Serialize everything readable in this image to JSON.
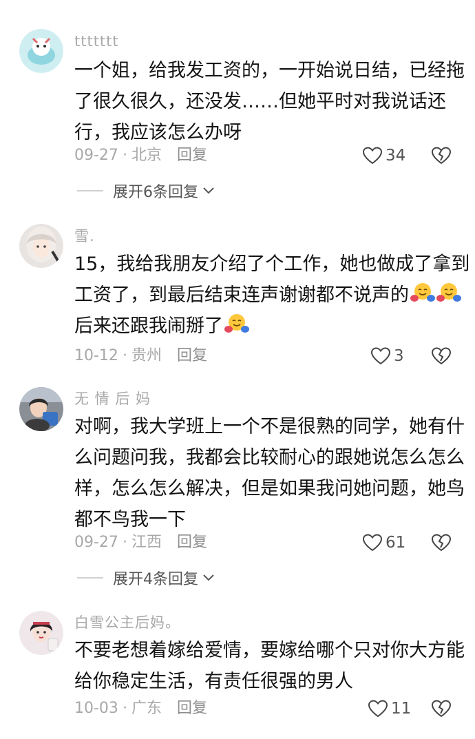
{
  "comments": [
    {
      "username": "ttttttt",
      "lines": [
        "一个姐，给我发工资的，一开始说日结，已经拖",
        "了很久很久，还没发……但她平时对我说话还",
        "行，我应该怎么办呀"
      ],
      "date": "09-27",
      "location": "北京",
      "reply_label": "回复",
      "likes": "34",
      "expand_label": "展开6条回复"
    },
    {
      "username": "雪.",
      "lines": [
        "15，我给我朋友介绍了个工作，她也做成了拿到",
        "工资了，到最后结束连声谢谢都不说声的",
        "后来还跟我闹掰了"
      ],
      "date": "10-12",
      "location": "贵州",
      "reply_label": "回复",
      "likes": "3"
    },
    {
      "username": "无 情 后 妈",
      "lines": [
        "对啊，我大学班上一个不是很熟的同学，她有什",
        "么问题问我，我都会比较耐心的跟她说怎么怎么",
        "样，怎么怎么解决，但是如果我问她问题，她鸟",
        "都不鸟我一下"
      ],
      "date": "09-27",
      "location": "江西",
      "reply_label": "回复",
      "likes": "61",
      "expand_label": "展开4条回复"
    },
    {
      "username": "白雪公主后妈。",
      "lines": [
        "不要老想着嫁给爱情，要嫁给哪个只对你大方能",
        "给你稳定生活，有责任很强的男人"
      ],
      "date": "10-03",
      "location": "广东",
      "reply_label": "回复",
      "likes": "11"
    }
  ],
  "icons": {
    "like": "heart-outline-icon",
    "dislike": "broken-heart-icon",
    "expand": "chevron-down-icon",
    "emoji": "hugging-face-emoji"
  },
  "colors": {
    "text": "#141414",
    "meta": "#a8a8a8",
    "reply": "#8e8e8e"
  }
}
